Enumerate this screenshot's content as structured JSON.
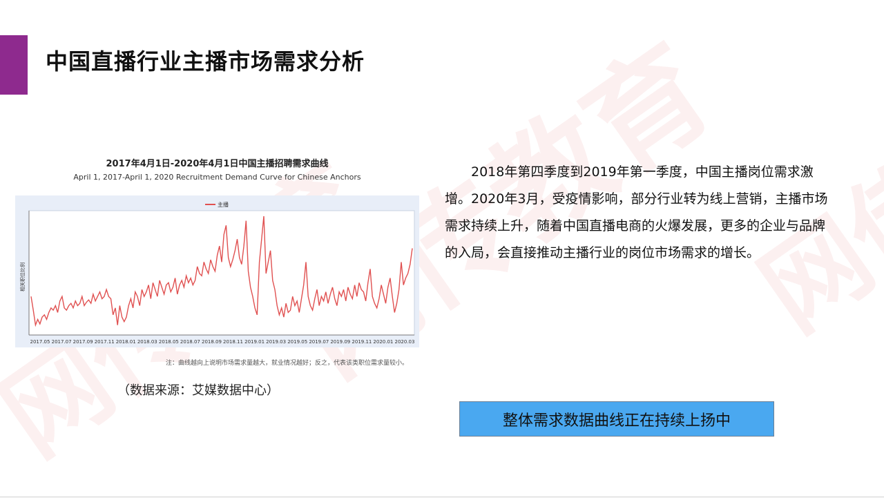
{
  "slide": {
    "title": "中国直播行业主播市场需求分析",
    "accent_color": "#8e2a8e",
    "watermark_text": "网传教育"
  },
  "chart_block": {
    "title": "2017年4月1日-2020年4月1日中国主播招聘需求曲线",
    "subtitle": "April 1, 2017-April 1, 2020 Recruitment Demand Curve for Chinese Anchors",
    "note": "注：曲线越向上说明市场需求量越大，就业情况越好；反之，代表该类职位需求量较小。",
    "source": "（数据来源：艾媒数据中心）"
  },
  "chart_data": {
    "type": "line",
    "title": "2017年4月1日-2020年4月1日中国主播招聘需求曲线",
    "subtitle": "April 1, 2017-April 1, 2020 Recruitment Demand Curve for Chinese Anchors",
    "xlabel": "",
    "ylabel": "相关职位比例",
    "legend_position": "top-center",
    "grid": false,
    "ylim": [
      0,
      100
    ],
    "x_ticks": [
      "2017.05",
      "2017.07",
      "2017.09",
      "2017.11",
      "2018.01",
      "2018.03",
      "2018.05",
      "2018.07",
      "2018.09",
      "2018.11",
      "2019.01",
      "2019.03",
      "2019.05",
      "2019.07",
      "2019.09",
      "2019.11",
      "2020.01",
      "2020.03"
    ],
    "series": [
      {
        "name": "主播",
        "color": "#e05050",
        "x_start": "2017.04",
        "x_end": "2020.04",
        "values": [
          30,
          18,
          5,
          10,
          6,
          12,
          14,
          10,
          16,
          20,
          18,
          22,
          16,
          26,
          30,
          20,
          18,
          22,
          24,
          20,
          26,
          22,
          24,
          30,
          22,
          25,
          27,
          24,
          32,
          26,
          30,
          34,
          28,
          30,
          36,
          30,
          28,
          14,
          20,
          5,
          22,
          12,
          8,
          12,
          22,
          28,
          20,
          34,
          30,
          22,
          36,
          30,
          34,
          40,
          28,
          42,
          36,
          30,
          44,
          38,
          32,
          40,
          42,
          34,
          38,
          46,
          32,
          40,
          44,
          38,
          48,
          42,
          46,
          40,
          44,
          56,
          50,
          48,
          60,
          54,
          50,
          62,
          56,
          52,
          66,
          74,
          60,
          84,
          92,
          64,
          56,
          62,
          70,
          80,
          64,
          58,
          74,
          96,
          52,
          38,
          30,
          20,
          14,
          60,
          80,
          100,
          50,
          60,
          70,
          44,
          36,
          22,
          14,
          20,
          12,
          24,
          16,
          18,
          30,
          22,
          26,
          16,
          28,
          40,
          60,
          30,
          22,
          18,
          28,
          36,
          22,
          30,
          26,
          34,
          24,
          32,
          38,
          28,
          22,
          34,
          30,
          36,
          26,
          38,
          32,
          28,
          40,
          30,
          42,
          36,
          34,
          26,
          42,
          54,
          30,
          24,
          20,
          28,
          40,
          32,
          24,
          38,
          46,
          30,
          16,
          24,
          36,
          60,
          40,
          46,
          50,
          58,
          72
        ]
      }
    ]
  },
  "paragraph": {
    "text": "2018年第四季度到2019年第一季度，中国主播岗位需求激增。2020年3月，受疫情影响，部分行业转为线上营销，主播市场需求持续上升，随着中国直播电商的火爆发展，更多的企业与品牌的入局，会直接推动主播行业的岗位市场需求的增长。"
  },
  "callout": {
    "text": "整体需求数据曲线正在持续上扬中",
    "fill_color": "#4aa8f0"
  }
}
